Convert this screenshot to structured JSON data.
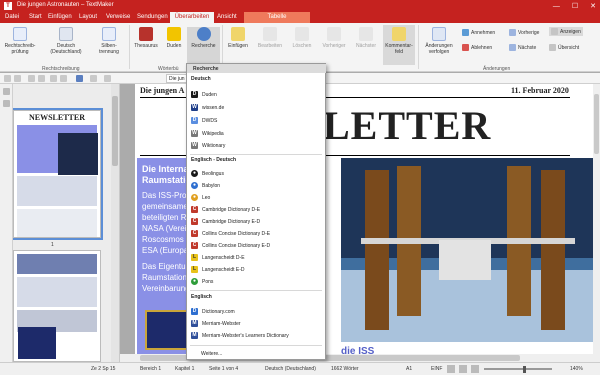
{
  "window": {
    "title": "Die jungen Astronauten – TextMaker",
    "app_letter": "T",
    "min": "—",
    "max": "☐",
    "close": "✕"
  },
  "menu": {
    "items": [
      "Datei",
      "Start",
      "Einfügen",
      "Layout",
      "Verweise",
      "Sendungen"
    ],
    "active_tab": "Überarbeiten",
    "after": "Ansicht",
    "context_tab": "Tabelle"
  },
  "ribbon": {
    "spelling": "Rechtschreib-prüfung",
    "language": "Deutsch (Deutschland)",
    "hyphen": "Silben-trennung",
    "thesaurus": "Thesaurus",
    "duden": "Duden",
    "research": "Recherche",
    "insert": "Einfügen",
    "edit": "Bearbeiten",
    "delete": "Löschen",
    "prev": "Vorheriger",
    "next": "Nächster",
    "comment_field": "Kommentar-feld",
    "track": "Änderungen verfolgen",
    "accept": "Annehmen",
    "reject": "Ablehnen",
    "previous": "Vorherige",
    "nextc": "Nächste",
    "show": "Anzeigen",
    "overview": "Übersicht",
    "group_spelling": "Rechtschreibung",
    "group_words": "Wörterbü",
    "group_changes": "Änderungen"
  },
  "toolbar": {
    "style_value": "Die jun"
  },
  "document": {
    "header_left": "Die jungen A",
    "header_right": "11. Februar 2020",
    "newsletter": "LETTER",
    "box_title_1": "Die Internat",
    "box_title_2": "Raumstatio",
    "para1": [
      "Das ISS-Prog",
      "gemeinsame",
      "beteiligten R",
      "NASA (Verei",
      "Roscosmos (",
      "ESA (Europa"
    ],
    "para2": [
      "Das Eigentun",
      "Raumstation",
      "Vereinbarung"
    ],
    "bottom_heading": "die ISS"
  },
  "thumbs": {
    "page1_title": "NEWSLETTER",
    "page_num_1": "1",
    "page_num_2": "2"
  },
  "dropdown": {
    "header": "Recherche",
    "sections": [
      {
        "title": "Deutsch",
        "items": [
          {
            "label": "Duden",
            "icon": "D",
            "color": "#1a1a1a"
          },
          {
            "label": "wissen.de",
            "icon": "W",
            "color": "#1f3f8a"
          },
          {
            "label": "DWDS",
            "icon": "D",
            "color": "#5a8ee0"
          },
          {
            "label": "Wikipedia",
            "icon": "W",
            "color": "#777777"
          },
          {
            "label": "Wiktionary",
            "icon": "W",
            "color": "#777777"
          }
        ]
      },
      {
        "title": "Englisch - Deutsch",
        "items": [
          {
            "label": "Beolingus",
            "icon": "●",
            "color": "#1a1a1a"
          },
          {
            "label": "Babylon",
            "icon": "●",
            "color": "#2f6fd0"
          },
          {
            "label": "Leo",
            "icon": "●",
            "color": "#e0a020"
          },
          {
            "label": "Cambridge Dictionary D-E",
            "icon": "C",
            "color": "#c0392b"
          },
          {
            "label": "Cambridge Dictionary E-D",
            "icon": "C",
            "color": "#c0392b"
          },
          {
            "label": "Collins Concise Dictionary D-E",
            "icon": "C",
            "color": "#c0392b"
          },
          {
            "label": "Collins Concise Dictionary E-D",
            "icon": "C",
            "color": "#c0392b"
          },
          {
            "label": "Langenscheidt D-E",
            "icon": "L",
            "color": "#e8c21a"
          },
          {
            "label": "Langenscheidt E-D",
            "icon": "L",
            "color": "#e8c21a"
          },
          {
            "label": "Pons",
            "icon": "●",
            "color": "#2e9d3a"
          }
        ]
      },
      {
        "title": "Englisch",
        "items": [
          {
            "label": "Dictionary.com",
            "icon": "D",
            "color": "#2f6fd0"
          },
          {
            "label": "Merriam-Webster",
            "icon": "M",
            "color": "#2f4f9a"
          },
          {
            "label": "Merriam-Webster's Learners Dictionary",
            "icon": "M",
            "color": "#2f4f9a"
          }
        ]
      }
    ],
    "more": "Weitere..."
  },
  "status": {
    "pos": "Ze 2 Sp 15",
    "area": "Bereich 1",
    "chapter": "Kapitel 1",
    "page": "Seite 1 von 4",
    "lang": "Deutsch (Deutschland)",
    "words": "1662 Wörter",
    "cell": "A1",
    "mode": "EINF",
    "zoom": "140%"
  },
  "colors": {
    "accent": "#c5221f",
    "box_bg": "#8a90e6",
    "tab_tabelle": "#ef7a5c"
  }
}
